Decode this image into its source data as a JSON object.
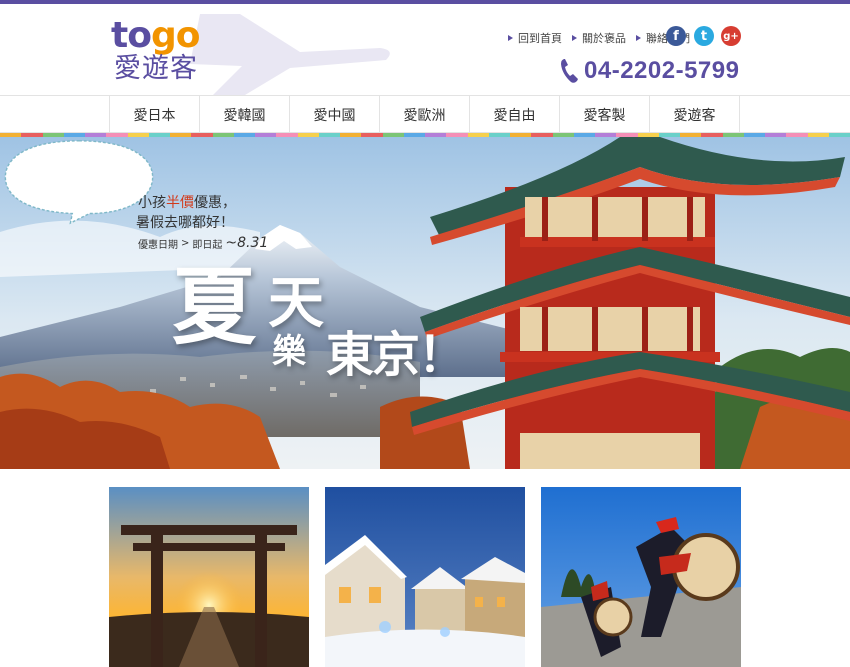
{
  "brand": {
    "logo_latin_to": "to",
    "logo_latin_go": "go",
    "logo_chinese": "愛遊客",
    "primary_color": "#5a4ea1",
    "accent_color": "#f29400"
  },
  "header": {
    "links": [
      {
        "label": "回到首頁"
      },
      {
        "label": "關於褒品"
      },
      {
        "label": "聯絡我們"
      }
    ],
    "social": [
      {
        "name": "facebook-icon",
        "glyph": "f"
      },
      {
        "name": "twitter-icon",
        "glyph": "t"
      },
      {
        "name": "google-plus-icon",
        "glyph": "g+"
      }
    ],
    "phone": "04-2202-5799"
  },
  "nav": {
    "items": [
      {
        "label": "愛日本"
      },
      {
        "label": "愛韓國"
      },
      {
        "label": "愛中國"
      },
      {
        "label": "愛歐洲"
      },
      {
        "label": "愛自由"
      },
      {
        "label": "愛客製"
      },
      {
        "label": "愛遊客"
      }
    ],
    "stripe_colors": [
      "#f2b134",
      "#e85f5f",
      "#7cc576",
      "#5aa9e6",
      "#b47fd8",
      "#f58fb7",
      "#f6d04d",
      "#6ad0c9"
    ]
  },
  "hero": {
    "bubble_line1_pre": "小孩",
    "bubble_line1_red": "半價",
    "bubble_line1_post": "優惠，",
    "bubble_line2": "暑假去哪都好！",
    "bubble_line3_label": "優惠日期",
    "bubble_line3_mid": "即日起",
    "bubble_line3_date": "~8.31",
    "title_char1": "夏",
    "title_char2": "天",
    "title_char3": "樂",
    "title_rest": "東京！"
  },
  "thumbnails": [
    {
      "name": "torii-gate-sunset"
    },
    {
      "name": "snowy-village-night"
    },
    {
      "name": "okinawa-drum-dancers"
    }
  ]
}
